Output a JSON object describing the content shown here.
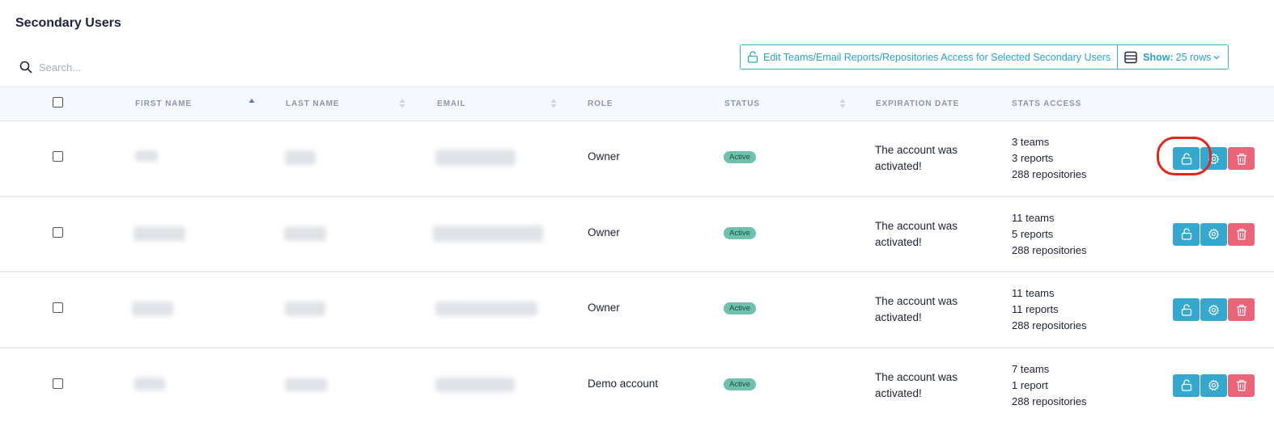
{
  "page": {
    "title": "Secondary Users"
  },
  "search": {
    "placeholder": "Search..."
  },
  "toolbar": {
    "edit_access_label": "Edit Teams/Email Reports/Repositories Access for Selected Secondary Users",
    "show_label": "Show:",
    "rows_value": "25 rows"
  },
  "columns": {
    "first_name": "FIRST NAME",
    "last_name": "LAST NAME",
    "email": "EMAIL",
    "role": "ROLE",
    "status": "STATUS",
    "expiration_date": "EXPIRATION DATE",
    "stats_access": "STATS ACCESS"
  },
  "rows": [
    {
      "role": "Owner",
      "status": "Active",
      "expiration": "The account was activated!",
      "teams": "3 teams",
      "reports": "3 reports",
      "repositories": "288 repositories"
    },
    {
      "role": "Owner",
      "status": "Active",
      "expiration": "The account was activated!",
      "teams": "11 teams",
      "reports": "5 reports",
      "repositories": "288 repositories"
    },
    {
      "role": "Owner",
      "status": "Active",
      "expiration": "The account was activated!",
      "teams": "11 teams",
      "reports": "11 reports",
      "repositories": "288 repositories"
    },
    {
      "role": "Demo account",
      "status": "Active",
      "expiration": "The account was activated!",
      "teams": "7 teams",
      "reports": "1 report",
      "repositories": "288 repositories"
    }
  ],
  "icons": {
    "search": "search-icon",
    "unlock": "unlock-icon",
    "table": "table-rows-icon",
    "chevron": "chevron-down-icon",
    "sort": "sort-icon",
    "gear": "gear-icon",
    "trash": "trash-icon"
  },
  "colors": {
    "accent": "#35a8cf",
    "danger": "#ec6477",
    "badge": "#6dc1ae",
    "highlight": "#e5261b"
  }
}
